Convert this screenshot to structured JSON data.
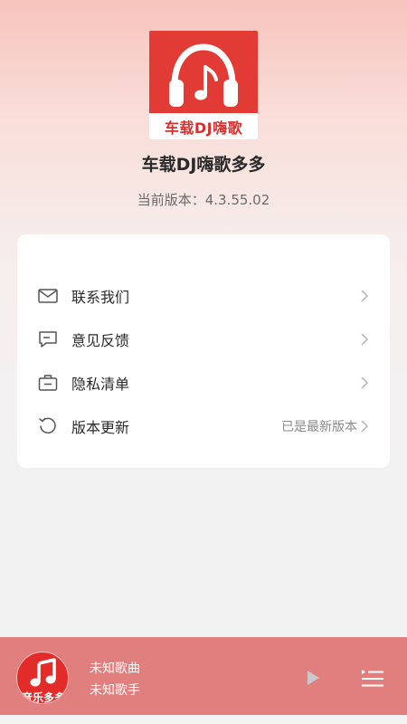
{
  "app": {
    "logo_text": "车载DJ嗨歌",
    "name": "车载DJ嗨歌多多",
    "version": "当前版本：4.3.55.02"
  },
  "menu": {
    "items": [
      {
        "label": "联系我们",
        "icon": "mail-icon",
        "right": ""
      },
      {
        "label": "意见反馈",
        "icon": "chat-icon",
        "right": ""
      },
      {
        "label": "隐私清单",
        "icon": "briefcase-icon",
        "right": ""
      },
      {
        "label": "版本更新",
        "icon": "refresh-icon",
        "right": "已是最新版本"
      }
    ]
  },
  "player": {
    "cover_text": "音乐多多",
    "song_title": "未知歌曲",
    "artist": "未知歌手",
    "play_icon": "play-icon",
    "playlist_icon": "playlist-icon"
  },
  "colors": {
    "brand_red": "#e23b36",
    "player_bar": "#e07f7d",
    "card_bg": "#ffffff"
  }
}
